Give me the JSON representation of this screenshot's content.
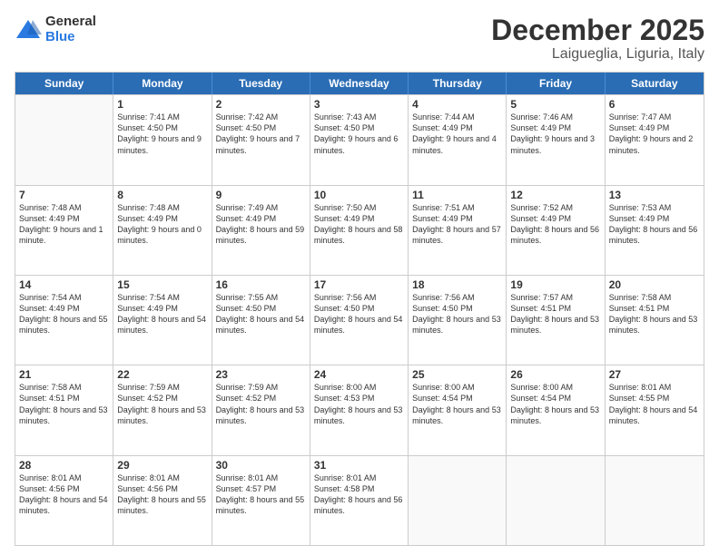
{
  "header": {
    "logo": {
      "general": "General",
      "blue": "Blue"
    },
    "title": "December 2025",
    "subtitle": "Laigueglia, Liguria, Italy"
  },
  "days": [
    "Sunday",
    "Monday",
    "Tuesday",
    "Wednesday",
    "Thursday",
    "Friday",
    "Saturday"
  ],
  "weeks": [
    [
      {
        "day": "",
        "empty": true
      },
      {
        "day": "1",
        "rise": "7:41 AM",
        "set": "4:50 PM",
        "daylight": "9 hours and 9 minutes."
      },
      {
        "day": "2",
        "rise": "7:42 AM",
        "set": "4:50 PM",
        "daylight": "9 hours and 7 minutes."
      },
      {
        "day": "3",
        "rise": "7:43 AM",
        "set": "4:50 PM",
        "daylight": "9 hours and 6 minutes."
      },
      {
        "day": "4",
        "rise": "7:44 AM",
        "set": "4:49 PM",
        "daylight": "9 hours and 4 minutes."
      },
      {
        "day": "5",
        "rise": "7:46 AM",
        "set": "4:49 PM",
        "daylight": "9 hours and 3 minutes."
      },
      {
        "day": "6",
        "rise": "7:47 AM",
        "set": "4:49 PM",
        "daylight": "9 hours and 2 minutes."
      }
    ],
    [
      {
        "day": "7",
        "rise": "7:48 AM",
        "set": "4:49 PM",
        "daylight": "9 hours and 1 minute."
      },
      {
        "day": "8",
        "rise": "7:48 AM",
        "set": "4:49 PM",
        "daylight": "9 hours and 0 minutes."
      },
      {
        "day": "9",
        "rise": "7:49 AM",
        "set": "4:49 PM",
        "daylight": "8 hours and 59 minutes."
      },
      {
        "day": "10",
        "rise": "7:50 AM",
        "set": "4:49 PM",
        "daylight": "8 hours and 58 minutes."
      },
      {
        "day": "11",
        "rise": "7:51 AM",
        "set": "4:49 PM",
        "daylight": "8 hours and 57 minutes."
      },
      {
        "day": "12",
        "rise": "7:52 AM",
        "set": "4:49 PM",
        "daylight": "8 hours and 56 minutes."
      },
      {
        "day": "13",
        "rise": "7:53 AM",
        "set": "4:49 PM",
        "daylight": "8 hours and 56 minutes."
      }
    ],
    [
      {
        "day": "14",
        "rise": "7:54 AM",
        "set": "4:49 PM",
        "daylight": "8 hours and 55 minutes."
      },
      {
        "day": "15",
        "rise": "7:54 AM",
        "set": "4:49 PM",
        "daylight": "8 hours and 54 minutes."
      },
      {
        "day": "16",
        "rise": "7:55 AM",
        "set": "4:50 PM",
        "daylight": "8 hours and 54 minutes."
      },
      {
        "day": "17",
        "rise": "7:56 AM",
        "set": "4:50 PM",
        "daylight": "8 hours and 54 minutes."
      },
      {
        "day": "18",
        "rise": "7:56 AM",
        "set": "4:50 PM",
        "daylight": "8 hours and 53 minutes."
      },
      {
        "day": "19",
        "rise": "7:57 AM",
        "set": "4:51 PM",
        "daylight": "8 hours and 53 minutes."
      },
      {
        "day": "20",
        "rise": "7:58 AM",
        "set": "4:51 PM",
        "daylight": "8 hours and 53 minutes."
      }
    ],
    [
      {
        "day": "21",
        "rise": "7:58 AM",
        "set": "4:51 PM",
        "daylight": "8 hours and 53 minutes."
      },
      {
        "day": "22",
        "rise": "7:59 AM",
        "set": "4:52 PM",
        "daylight": "8 hours and 53 minutes."
      },
      {
        "day": "23",
        "rise": "7:59 AM",
        "set": "4:52 PM",
        "daylight": "8 hours and 53 minutes."
      },
      {
        "day": "24",
        "rise": "8:00 AM",
        "set": "4:53 PM",
        "daylight": "8 hours and 53 minutes."
      },
      {
        "day": "25",
        "rise": "8:00 AM",
        "set": "4:54 PM",
        "daylight": "8 hours and 53 minutes."
      },
      {
        "day": "26",
        "rise": "8:00 AM",
        "set": "4:54 PM",
        "daylight": "8 hours and 53 minutes."
      },
      {
        "day": "27",
        "rise": "8:01 AM",
        "set": "4:55 PM",
        "daylight": "8 hours and 54 minutes."
      }
    ],
    [
      {
        "day": "28",
        "rise": "8:01 AM",
        "set": "4:56 PM",
        "daylight": "8 hours and 54 minutes."
      },
      {
        "day": "29",
        "rise": "8:01 AM",
        "set": "4:56 PM",
        "daylight": "8 hours and 55 minutes."
      },
      {
        "day": "30",
        "rise": "8:01 AM",
        "set": "4:57 PM",
        "daylight": "8 hours and 55 minutes."
      },
      {
        "day": "31",
        "rise": "8:01 AM",
        "set": "4:58 PM",
        "daylight": "8 hours and 56 minutes."
      },
      {
        "day": "",
        "empty": true
      },
      {
        "day": "",
        "empty": true
      },
      {
        "day": "",
        "empty": true
      }
    ]
  ]
}
